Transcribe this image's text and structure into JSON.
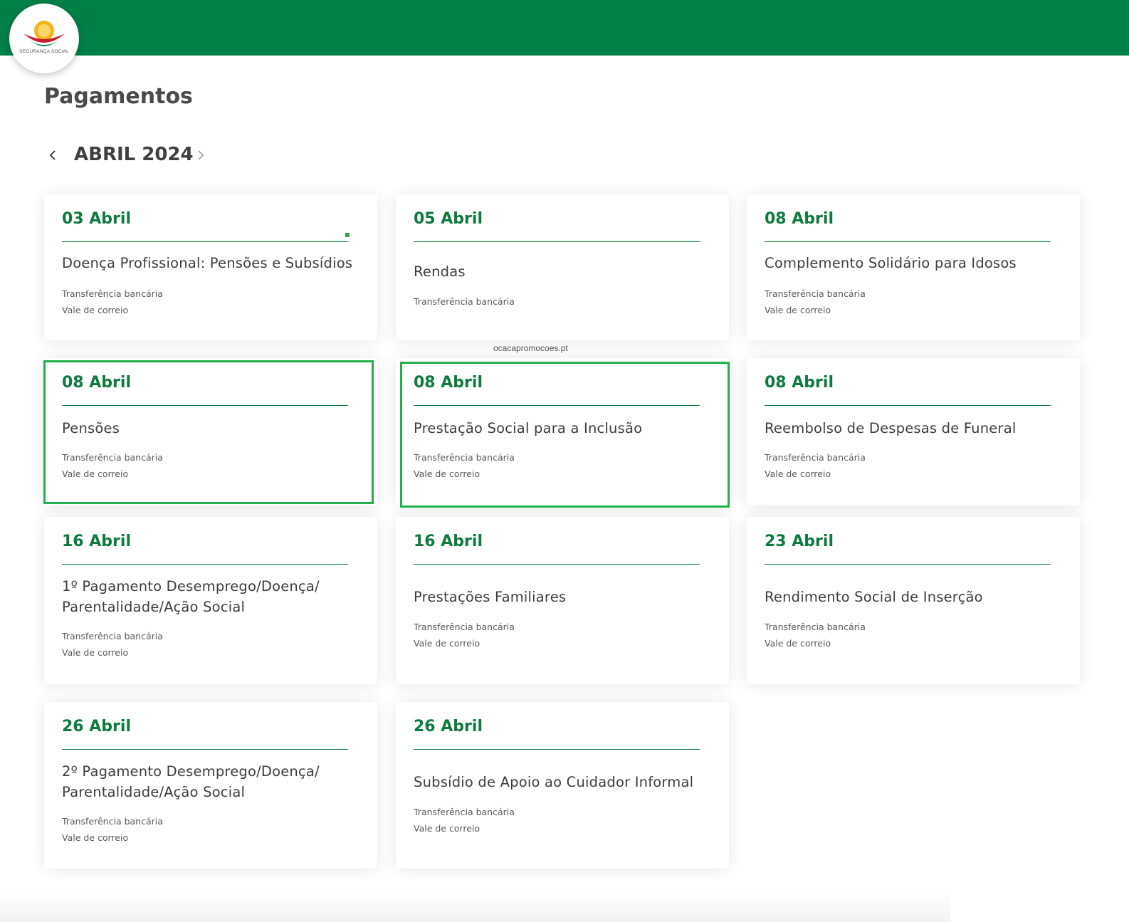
{
  "header": {
    "brand_color": "#007f47",
    "logo_text": "SEGURANÇA SOCIAL"
  },
  "page_title": "Pagamentos",
  "month_nav": {
    "current_month": "ABRIL 2024",
    "prev_icon": "chevron-left-icon",
    "next_icon": "chevron-right-icon"
  },
  "cards": [
    {
      "date": "03 Abril",
      "title": "Doença Profissional: Pensões e Subsídios",
      "methods": [
        "Transferência bancária",
        "Vale de correio"
      ]
    },
    {
      "date": "05 Abril",
      "title": "Rendas",
      "methods": [
        "Transferência bancária"
      ]
    },
    {
      "date": "08 Abril",
      "title": "Complemento Solidário para Idosos",
      "methods": [
        "Transferência bancária",
        "Vale de correio"
      ]
    },
    {
      "date": "08 Abril",
      "title": "Pensões",
      "methods": [
        "Transferência bancária",
        "Vale de correio"
      ],
      "highlighted": true
    },
    {
      "date": "08 Abril",
      "title": "Prestação Social para a Inclusão",
      "methods": [
        "Transferência bancária",
        "Vale de correio"
      ],
      "highlighted": true
    },
    {
      "date": "08 Abril",
      "title": "Reembolso de Despesas de Funeral",
      "methods": [
        "Transferência bancária",
        "Vale de correio"
      ]
    },
    {
      "date": "16 Abril",
      "title": "1º Pagamento Desemprego/Doença/ Parentalidade/Ação Social",
      "methods": [
        "Transferência bancária",
        "Vale de correio"
      ]
    },
    {
      "date": "16 Abril",
      "title": "Prestações Familiares",
      "methods": [
        "Transferência bancária",
        "Vale de correio"
      ]
    },
    {
      "date": "23 Abril",
      "title": "Rendimento Social de Inserção",
      "methods": [
        "Transferência bancária",
        "Vale de correio"
      ]
    },
    {
      "date": "26 Abril",
      "title": "2º Pagamento Desemprego/Doença/ Parentalidade/Ação Social",
      "methods": [
        "Transferência bancária",
        "Vale de correio"
      ]
    },
    {
      "date": "26 Abril",
      "title": "Subsídio de Apoio ao Cuidador Informal",
      "methods": [
        "Transferência bancária",
        "Vale de correio"
      ]
    }
  ],
  "watermark": "ocacapromocoes.pt",
  "colors": {
    "date_green": "#0d7a3e",
    "highlight_green": "#1fb04b"
  }
}
